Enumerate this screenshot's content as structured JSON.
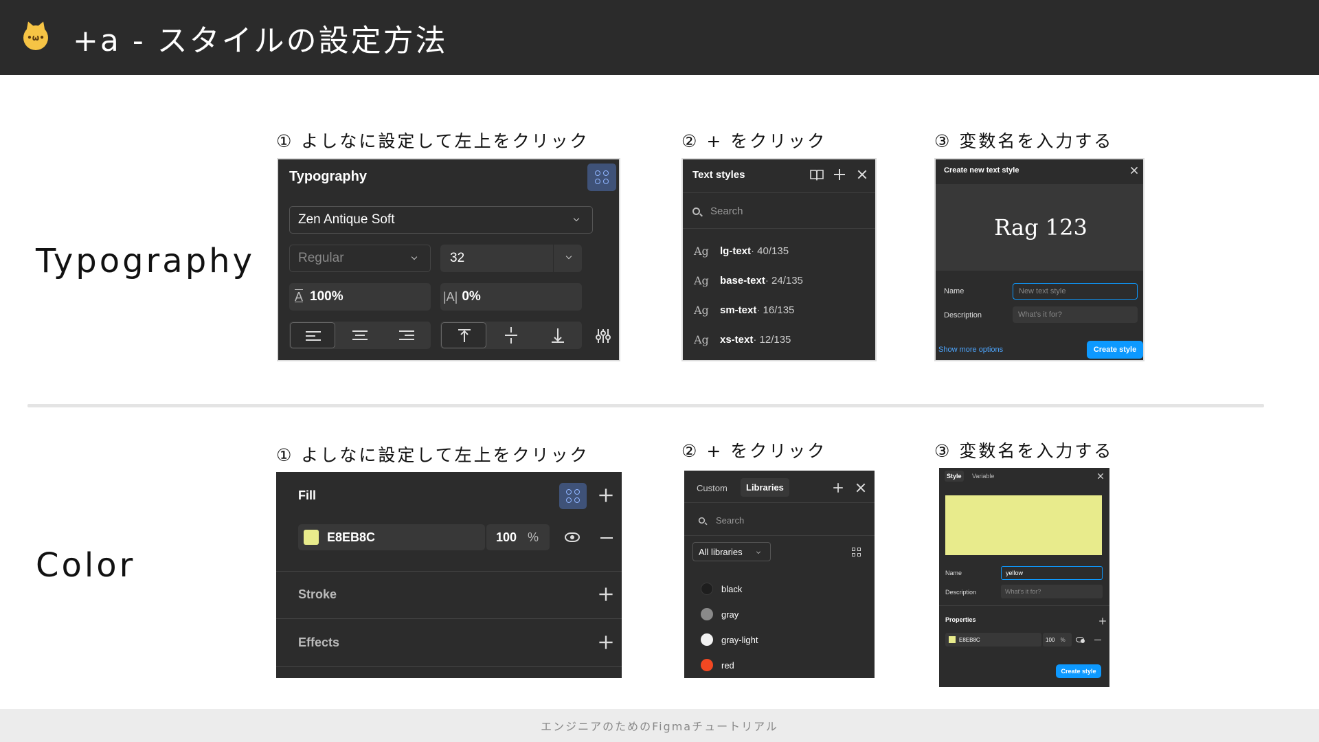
{
  "header": {
    "icon": "cat-face-icon",
    "title": "+a - スタイルの設定方法"
  },
  "rows": {
    "typography_label": "Typography",
    "color_label": "Color"
  },
  "steps": {
    "step1": "① よしなに設定して左上をクリック",
    "step2": "② + をクリック",
    "step3": "③ 変数名を入力する"
  },
  "typography_panel": {
    "title": "Typography",
    "font": "Zen Antique Soft",
    "weight": "Regular",
    "size": "32",
    "line_height": "100%",
    "letter_spacing": "0%",
    "line_height_icon": "A",
    "letter_spacing_icon": "|A|"
  },
  "text_styles_panel": {
    "title": "Text styles",
    "search_placeholder": "Search",
    "ag": "Ag",
    "items": [
      {
        "name": "lg-text",
        "meta": " · 40/135"
      },
      {
        "name": "base-text",
        "meta": " · 24/135"
      },
      {
        "name": "sm-text",
        "meta": " · 16/135"
      },
      {
        "name": "xs-text",
        "meta": " · 12/135"
      }
    ]
  },
  "create_text_style": {
    "title": "Create new text style",
    "preview": "Rag 123",
    "name_label": "Name",
    "name_placeholder": "New text style",
    "description_label": "Description",
    "description_placeholder": "What's it for?",
    "more_options": "Show more options",
    "create_button": "Create style"
  },
  "fill_panel": {
    "fill_title": "Fill",
    "hex": "E8EB8C",
    "opacity": "100",
    "percent": "%",
    "stroke_title": "Stroke",
    "effects_title": "Effects",
    "swatch_color": "#E8EB8C"
  },
  "libraries_panel": {
    "tab_custom": "Custom",
    "tab_libraries": "Libraries",
    "search_placeholder": "Search",
    "filter": "All libraries",
    "colors": [
      {
        "name": "black",
        "color": "#1e1e1e"
      },
      {
        "name": "gray",
        "color": "#8a8a8a"
      },
      {
        "name": "gray-light",
        "color": "#f2f2f2"
      },
      {
        "name": "red",
        "color": "#f24822"
      }
    ]
  },
  "create_color_style": {
    "tab_style": "Style",
    "tab_variable": "Variable",
    "preview_color": "#E8EB8C",
    "name_label": "Name",
    "name_value": "yellow",
    "description_label": "Description",
    "description_placeholder": "What's it for?",
    "properties_label": "Properties",
    "hex": "E8EB8C",
    "opacity": "100",
    "percent": "%",
    "create_button": "Create style"
  },
  "footer": {
    "text": "エンジニアのためのFigmaチュートリアル"
  }
}
